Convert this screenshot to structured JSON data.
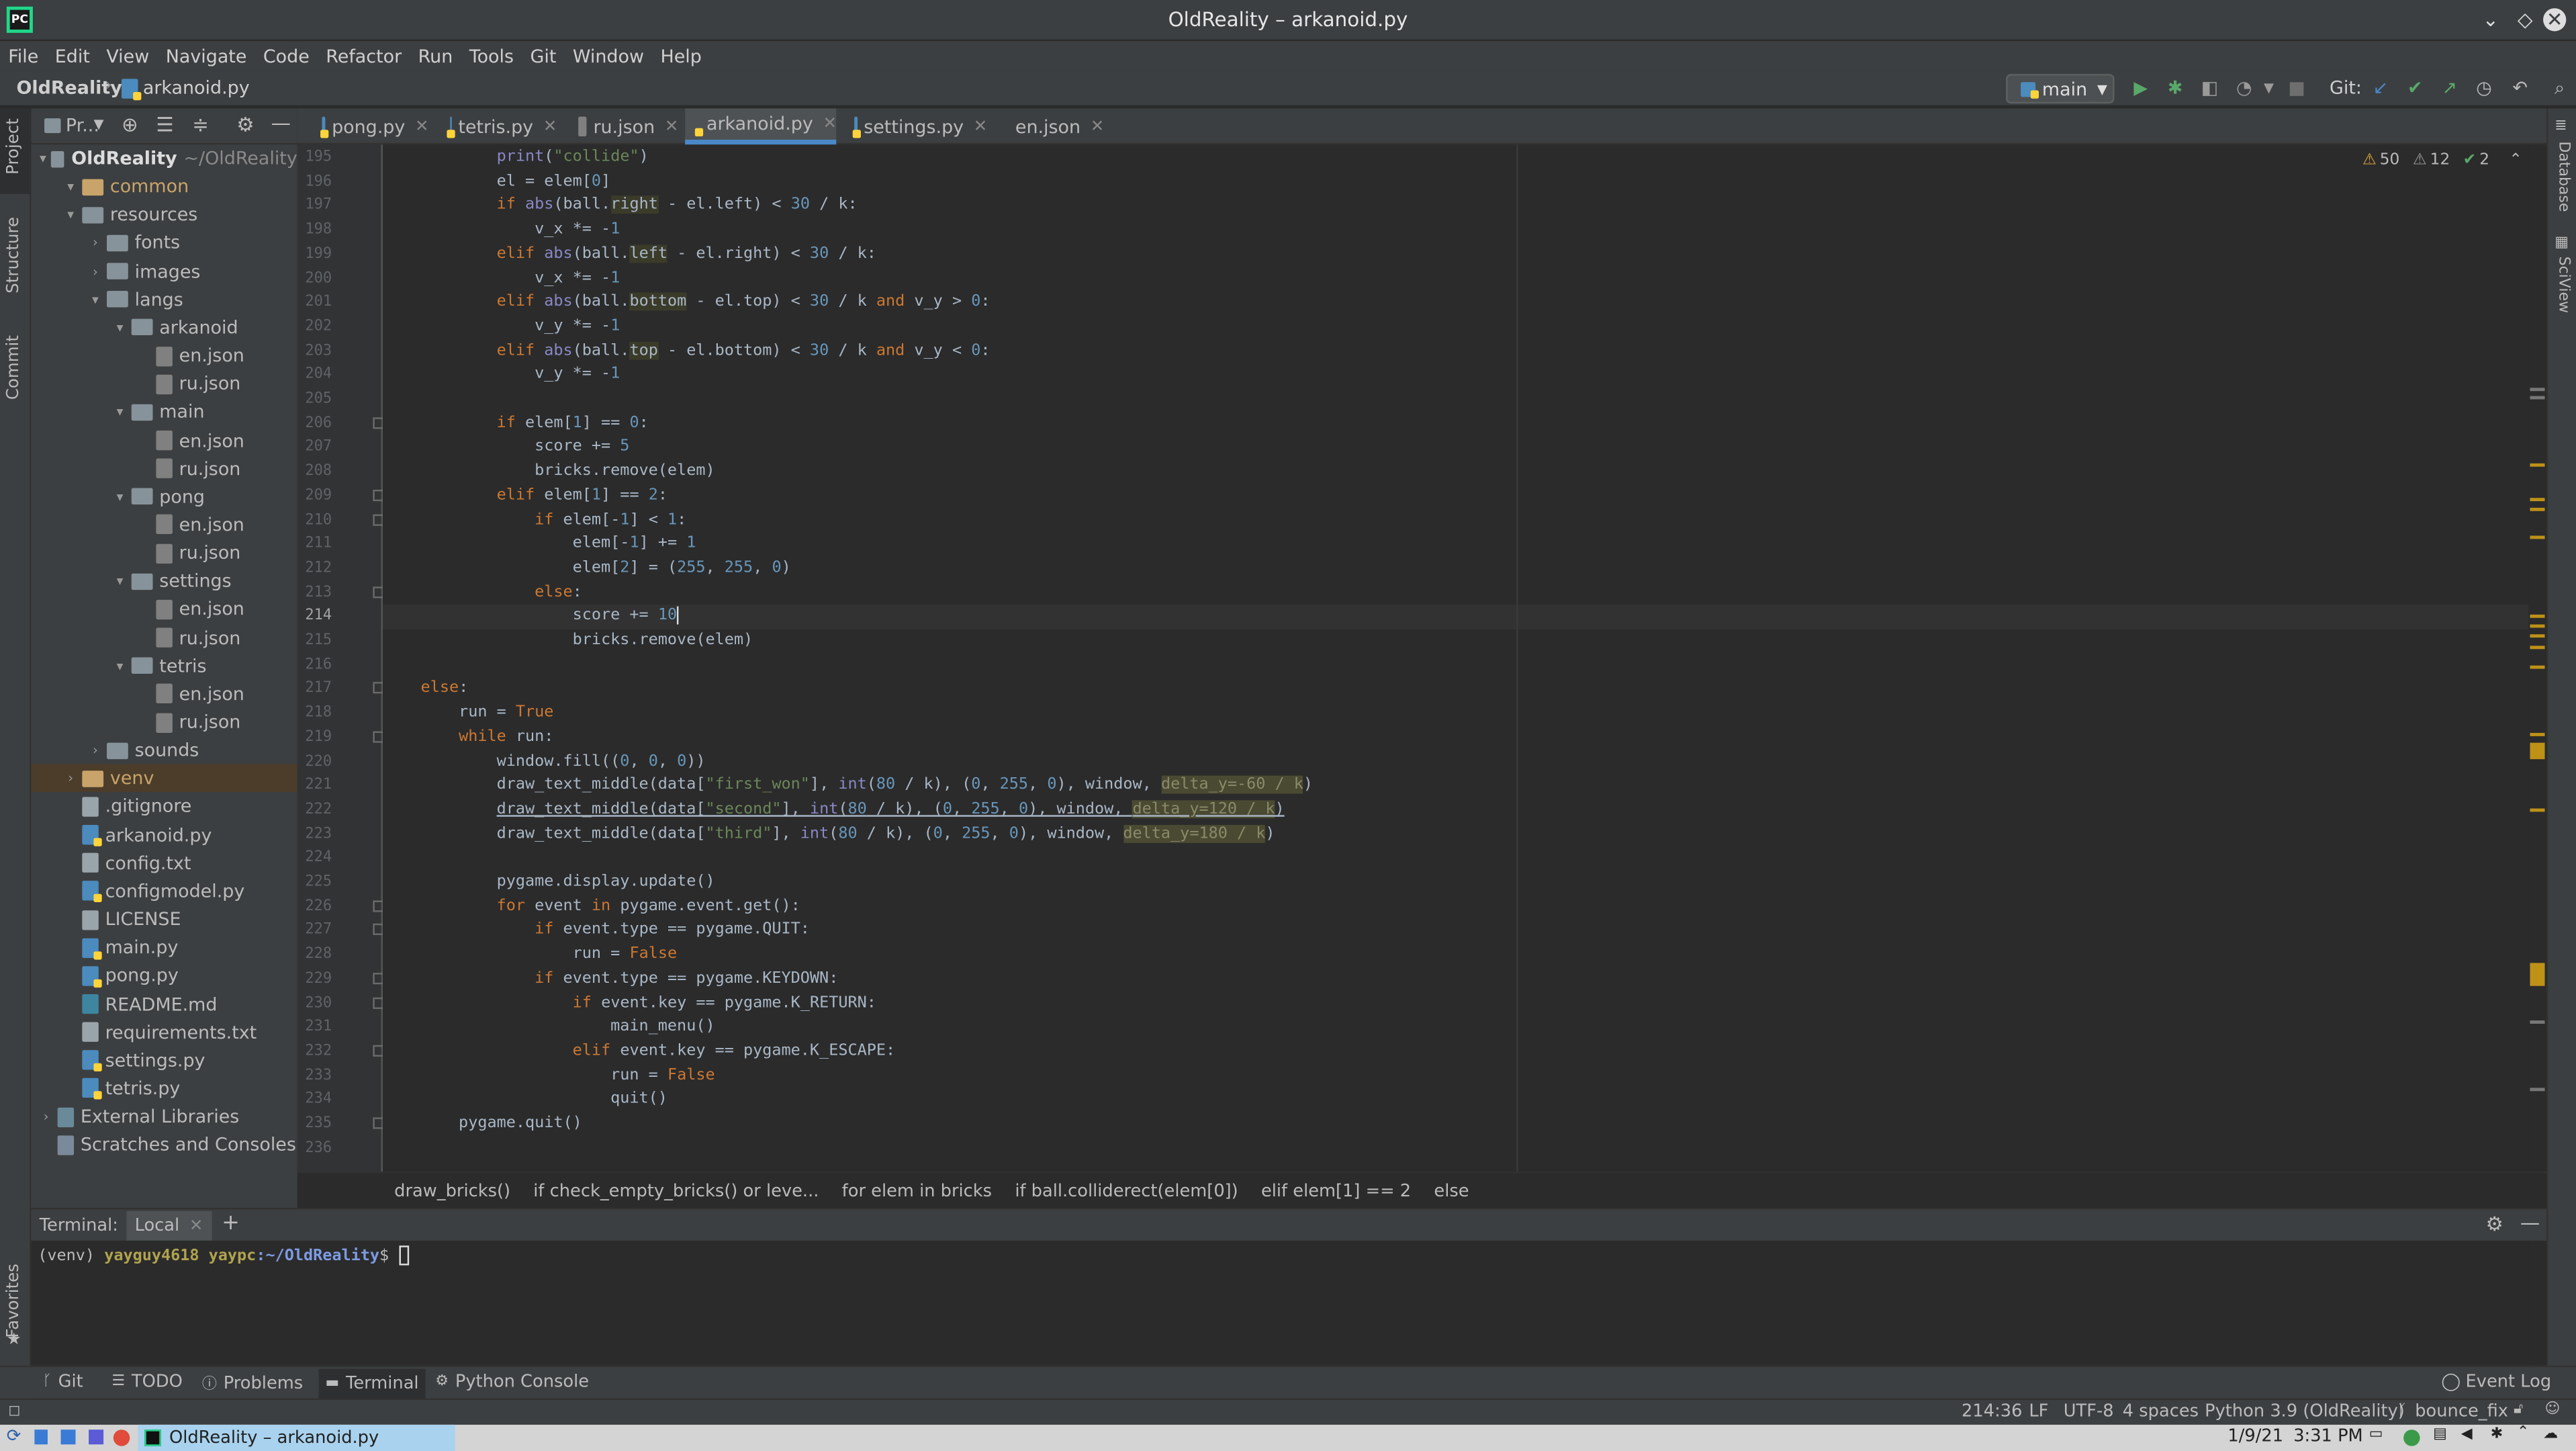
{
  "window": {
    "title": "OldReality – arkanoid.py"
  },
  "menu": [
    "File",
    "Edit",
    "View",
    "Navigate",
    "Code",
    "Refactor",
    "Run",
    "Tools",
    "Git",
    "Window",
    "Help"
  ],
  "nav": {
    "project": "OldReality",
    "file": "arkanoid.py",
    "branch": "main",
    "git_label": "Git:"
  },
  "left_tools": {
    "project": "Project",
    "structure": "Structure",
    "commit": "Commit",
    "favorites": "Favorites"
  },
  "right_tools": {
    "database": "Database",
    "sciview": "SciView"
  },
  "project_panel": {
    "label": "Pr..."
  },
  "tree": [
    {
      "depth": 0,
      "arrow": "▾",
      "icon": "folder",
      "name": "OldReality",
      "extra": "~/OldReality",
      "color": "#dcdcdc"
    },
    {
      "depth": 1,
      "arrow": "▾",
      "icon": "folder-o",
      "name": "common",
      "color": "#c8a46a"
    },
    {
      "depth": 1,
      "arrow": "▾",
      "icon": "folder",
      "name": "resources"
    },
    {
      "depth": 2,
      "arrow": "›",
      "icon": "folder",
      "name": "fonts"
    },
    {
      "depth": 2,
      "arrow": "›",
      "icon": "folder",
      "name": "images"
    },
    {
      "depth": 2,
      "arrow": "▾",
      "icon": "folder",
      "name": "langs"
    },
    {
      "depth": 3,
      "arrow": "▾",
      "icon": "folder",
      "name": "arkanoid"
    },
    {
      "depth": 4,
      "arrow": "",
      "icon": "json",
      "name": "en.json"
    },
    {
      "depth": 4,
      "arrow": "",
      "icon": "json",
      "name": "ru.json"
    },
    {
      "depth": 3,
      "arrow": "▾",
      "icon": "folder",
      "name": "main"
    },
    {
      "depth": 4,
      "arrow": "",
      "icon": "json",
      "name": "en.json"
    },
    {
      "depth": 4,
      "arrow": "",
      "icon": "json",
      "name": "ru.json"
    },
    {
      "depth": 3,
      "arrow": "▾",
      "icon": "folder",
      "name": "pong"
    },
    {
      "depth": 4,
      "arrow": "",
      "icon": "json",
      "name": "en.json"
    },
    {
      "depth": 4,
      "arrow": "",
      "icon": "json",
      "name": "ru.json"
    },
    {
      "depth": 3,
      "arrow": "▾",
      "icon": "folder",
      "name": "settings"
    },
    {
      "depth": 4,
      "arrow": "",
      "icon": "json",
      "name": "en.json"
    },
    {
      "depth": 4,
      "arrow": "",
      "icon": "json",
      "name": "ru.json"
    },
    {
      "depth": 3,
      "arrow": "▾",
      "icon": "folder",
      "name": "tetris"
    },
    {
      "depth": 4,
      "arrow": "",
      "icon": "json",
      "name": "en.json"
    },
    {
      "depth": 4,
      "arrow": "",
      "icon": "json",
      "name": "ru.json"
    },
    {
      "depth": 2,
      "arrow": "›",
      "icon": "folder",
      "name": "sounds"
    },
    {
      "depth": 1,
      "arrow": "›",
      "icon": "folder-o",
      "name": "venv",
      "color": "#c8a46a",
      "selected": true
    },
    {
      "depth": 1,
      "arrow": "",
      "icon": "txt",
      "name": ".gitignore"
    },
    {
      "depth": 1,
      "arrow": "",
      "icon": "py",
      "name": "arkanoid.py"
    },
    {
      "depth": 1,
      "arrow": "",
      "icon": "txt",
      "name": "config.txt"
    },
    {
      "depth": 1,
      "arrow": "",
      "icon": "py",
      "name": "configmodel.py"
    },
    {
      "depth": 1,
      "arrow": "",
      "icon": "txt",
      "name": "LICENSE"
    },
    {
      "depth": 1,
      "arrow": "",
      "icon": "py",
      "name": "main.py"
    },
    {
      "depth": 1,
      "arrow": "",
      "icon": "py",
      "name": "pong.py"
    },
    {
      "depth": 1,
      "arrow": "",
      "icon": "md",
      "name": "README.md"
    },
    {
      "depth": 1,
      "arrow": "",
      "icon": "txt",
      "name": "requirements.txt"
    },
    {
      "depth": 1,
      "arrow": "",
      "icon": "py",
      "name": "settings.py"
    },
    {
      "depth": 1,
      "arrow": "",
      "icon": "py",
      "name": "tetris.py"
    },
    {
      "depth": 0,
      "arrow": "›",
      "icon": "lib",
      "name": "External Libraries"
    },
    {
      "depth": 0,
      "arrow": "",
      "icon": "scratch",
      "name": "Scratches and Consoles"
    }
  ],
  "tabs": [
    {
      "label": "pong.py",
      "icon": "py"
    },
    {
      "label": "tetris.py",
      "icon": "py"
    },
    {
      "label": "ru.json",
      "icon": "json"
    },
    {
      "label": "arkanoid.py",
      "icon": "py",
      "active": true
    },
    {
      "label": "settings.py",
      "icon": "py"
    },
    {
      "label": "en.json",
      "icon": "json"
    }
  ],
  "inspections": {
    "warnings": "50",
    "weak": "12",
    "ok": "2"
  },
  "code": [
    {
      "n": "195",
      "html": "            <span class='bi'>print</span>(<span class='str'>\"collide\"</span>)"
    },
    {
      "n": "196",
      "html": "            el = elem[<span class='num'>0</span>]"
    },
    {
      "n": "197",
      "html": "            <span class='kw'>if</span> <span class='bi'>abs</span>(ball.<span class='hl'>right</span> - el.left) &lt; <span class='num'>30</span> / k:"
    },
    {
      "n": "198",
      "html": "                v_x *= -<span class='num'>1</span>"
    },
    {
      "n": "199",
      "html": "            <span class='kw'>elif</span> <span class='bi'>abs</span>(ball.<span class='hl'>left</span> - el.right) &lt; <span class='num'>30</span> / k:"
    },
    {
      "n": "200",
      "html": "                v_x *= -<span class='num'>1</span>"
    },
    {
      "n": "201",
      "html": "            <span class='kw'>elif</span> <span class='bi'>abs</span>(ball.<span class='hl'>bottom</span> - el.top) &lt; <span class='num'>30</span> / k <span class='kw'>and</span> v_y &gt; <span class='num'>0</span>:"
    },
    {
      "n": "202",
      "html": "                v_y *= -<span class='num'>1</span>"
    },
    {
      "n": "203",
      "html": "            <span class='kw'>elif</span> <span class='bi'>abs</span>(ball.<span class='hl'>top</span> - el.bottom) &lt; <span class='num'>30</span> / k <span class='kw'>and</span> v_y &lt; <span class='num'>0</span>:"
    },
    {
      "n": "204",
      "html": "                v_y *= -<span class='num'>1</span>"
    },
    {
      "n": "205",
      "html": ""
    },
    {
      "n": "206",
      "html": "            <span class='kw'>if</span> elem[<span class='num'>1</span>] == <span class='num'>0</span>:"
    },
    {
      "n": "207",
      "html": "                score += <span class='num'>5</span>"
    },
    {
      "n": "208",
      "html": "                bricks.remove(elem)"
    },
    {
      "n": "209",
      "html": "            <span class='kw'>elif</span> elem[<span class='num'>1</span>] == <span class='num'>2</span>:"
    },
    {
      "n": "210",
      "html": "                <span class='kw'>if</span> elem[-<span class='num'>1</span>] &lt; <span class='num'>1</span>:"
    },
    {
      "n": "211",
      "html": "                    elem[-<span class='num'>1</span>] += <span class='num'>1</span>"
    },
    {
      "n": "212",
      "html": "                    elem[<span class='num'>2</span>] = (<span class='num'>255</span>, <span class='num'>255</span>, <span class='num'>0</span>)"
    },
    {
      "n": "213",
      "html": "                <span class='kw'>else</span>:"
    },
    {
      "n": "214",
      "html": "                    score += <span class='num'>10</span><span style='border-left:1px solid #ddd'></span>",
      "cur": true
    },
    {
      "n": "215",
      "html": "                    bricks.remove(elem)"
    },
    {
      "n": "216",
      "html": ""
    },
    {
      "n": "217",
      "html": "    <span class='kw'>else</span>:"
    },
    {
      "n": "218",
      "html": "        run = <span class='kw'>True</span>"
    },
    {
      "n": "219",
      "html": "        <span class='kw'>while</span> run:"
    },
    {
      "n": "220",
      "html": "            window.fill((<span class='num'>0</span>, <span class='num'>0</span>, <span class='num'>0</span>))"
    },
    {
      "n": "221",
      "html": "            draw_text_middle(data[<span class='str'>\"first_won\"</span>], <span class='bi'>int</span>(<span class='num'>80</span> / k), (<span class='num'>0</span>, <span class='num'>255</span>, <span class='num'>0</span>), window, <span class='wrn'>delta_y=-60 / k</span>)"
    },
    {
      "n": "222",
      "html": "            <u>draw_text_middle(data[<span class='str'>\"second\"</span>], <span class='bi'>int</span>(<span class='num'>80</span> / k), (<span class='num'>0</span>, <span class='num'>255</span>, <span class='num'>0</span>), window, <span class='wrn'>delta_y=120 / k</span>)</u>"
    },
    {
      "n": "223",
      "html": "            draw_text_middle(data[<span class='str'>\"third\"</span>], <span class='bi'>int</span>(<span class='num'>80</span> / k), (<span class='num'>0</span>, <span class='num'>255</span>, <span class='num'>0</span>), window, <span class='wrn'>delta_y=180 / k</span>)"
    },
    {
      "n": "224",
      "html": ""
    },
    {
      "n": "225",
      "html": "            pygame.display.update()"
    },
    {
      "n": "226",
      "html": "            <span class='kw'>for</span> event <span class='kw'>in</span> pygame.event.get():"
    },
    {
      "n": "227",
      "html": "                <span class='kw'>if</span> event.type == pygame.QUIT:"
    },
    {
      "n": "228",
      "html": "                    run = <span class='kw'>False</span>"
    },
    {
      "n": "229",
      "html": "                <span class='kw'>if</span> event.type == pygame.KEYDOWN:"
    },
    {
      "n": "230",
      "html": "                    <span class='kw'>if</span> event.key == pygame.K_RETURN:"
    },
    {
      "n": "231",
      "html": "                        main_menu()"
    },
    {
      "n": "232",
      "html": "                    <span class='kw'>elif</span> event.key == pygame.K_ESCAPE:"
    },
    {
      "n": "233",
      "html": "                        run = <span class='kw'>False</span>"
    },
    {
      "n": "234",
      "html": "                        quit()"
    },
    {
      "n": "235",
      "html": "        pygame.quit()"
    },
    {
      "n": "236",
      "html": ""
    }
  ],
  "breadcrumbs": [
    "draw_bricks()",
    "if check_empty_bricks() or leve...",
    "for elem in bricks",
    "if ball.colliderect(elem[0])",
    "elif elem[1] == 2",
    "else"
  ],
  "terminal": {
    "label": "Terminal:",
    "tab": "Local",
    "prompt_env": "(venv)",
    "user": "yayguy4618",
    "host": "yaypc",
    "path": ":~/OldReality",
    "sym": "$"
  },
  "bottom_tabs": [
    "Git",
    "TODO",
    "Problems",
    "Terminal",
    "Python Console"
  ],
  "event_log": "Event Log",
  "status": {
    "position": "214:36",
    "line_sep": "LF",
    "encoding": "UTF-8",
    "indent": "4 spaces",
    "interpreter": "Python 3.9 (OldReality)",
    "branch": "bounce_fix"
  },
  "taskbar": {
    "task": "OldReality – arkanoid.py",
    "date": "1/9/21",
    "time": "3:31 PM"
  }
}
